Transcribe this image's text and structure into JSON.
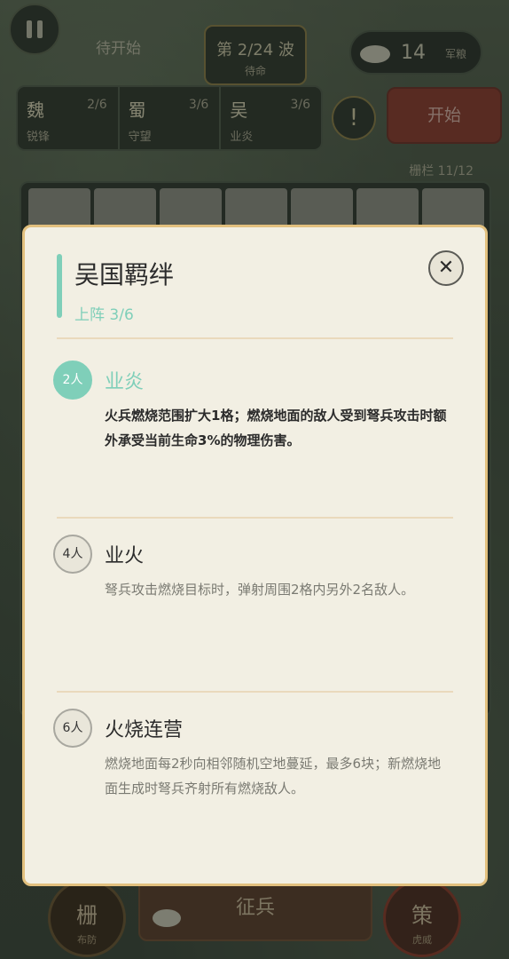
{
  "hud": {
    "status": "待开始",
    "wave": "第 2/24 波",
    "wave_state": "待命",
    "grain_value": "14",
    "grain_label": "军粮",
    "alert_symbol": "!",
    "start_label": "开始",
    "fence_label": "栅栏 11/12"
  },
  "factions": [
    {
      "name": "魏",
      "count": "2/6",
      "bond": "锐锋"
    },
    {
      "name": "蜀",
      "count": "3/6",
      "bond": "守望"
    },
    {
      "name": "吴",
      "count": "3/6",
      "bond": "业炎"
    }
  ],
  "bottom": {
    "left_char": "栅",
    "left_sub": "布防",
    "recruit_label": "征兵",
    "right_char": "策",
    "right_sub": "虎威"
  },
  "modal": {
    "title": "吴国羁绊",
    "subtitle": "上阵 3/6",
    "close_symbol": "✕",
    "tiers": [
      {
        "badge": "2人",
        "name": "业炎",
        "desc": "火兵燃烧范围扩大1格；燃烧地面的敌人受到弩兵攻击时额外承受当前生命3%的物理伤害。",
        "active": true
      },
      {
        "badge": "4人",
        "name": "业火",
        "desc": "弩兵攻击燃烧目标时，弹射周围2格内另外2名敌人。",
        "active": false
      },
      {
        "badge": "6人",
        "name": "火烧连营",
        "desc": "燃烧地面每2秒向相邻随机空地蔓延，最多6块；新燃烧地面生成时弩兵齐射所有燃烧敌人。",
        "active": false
      }
    ],
    "accent_color": "#7fcfb9",
    "border_color": "#e2c07e"
  }
}
